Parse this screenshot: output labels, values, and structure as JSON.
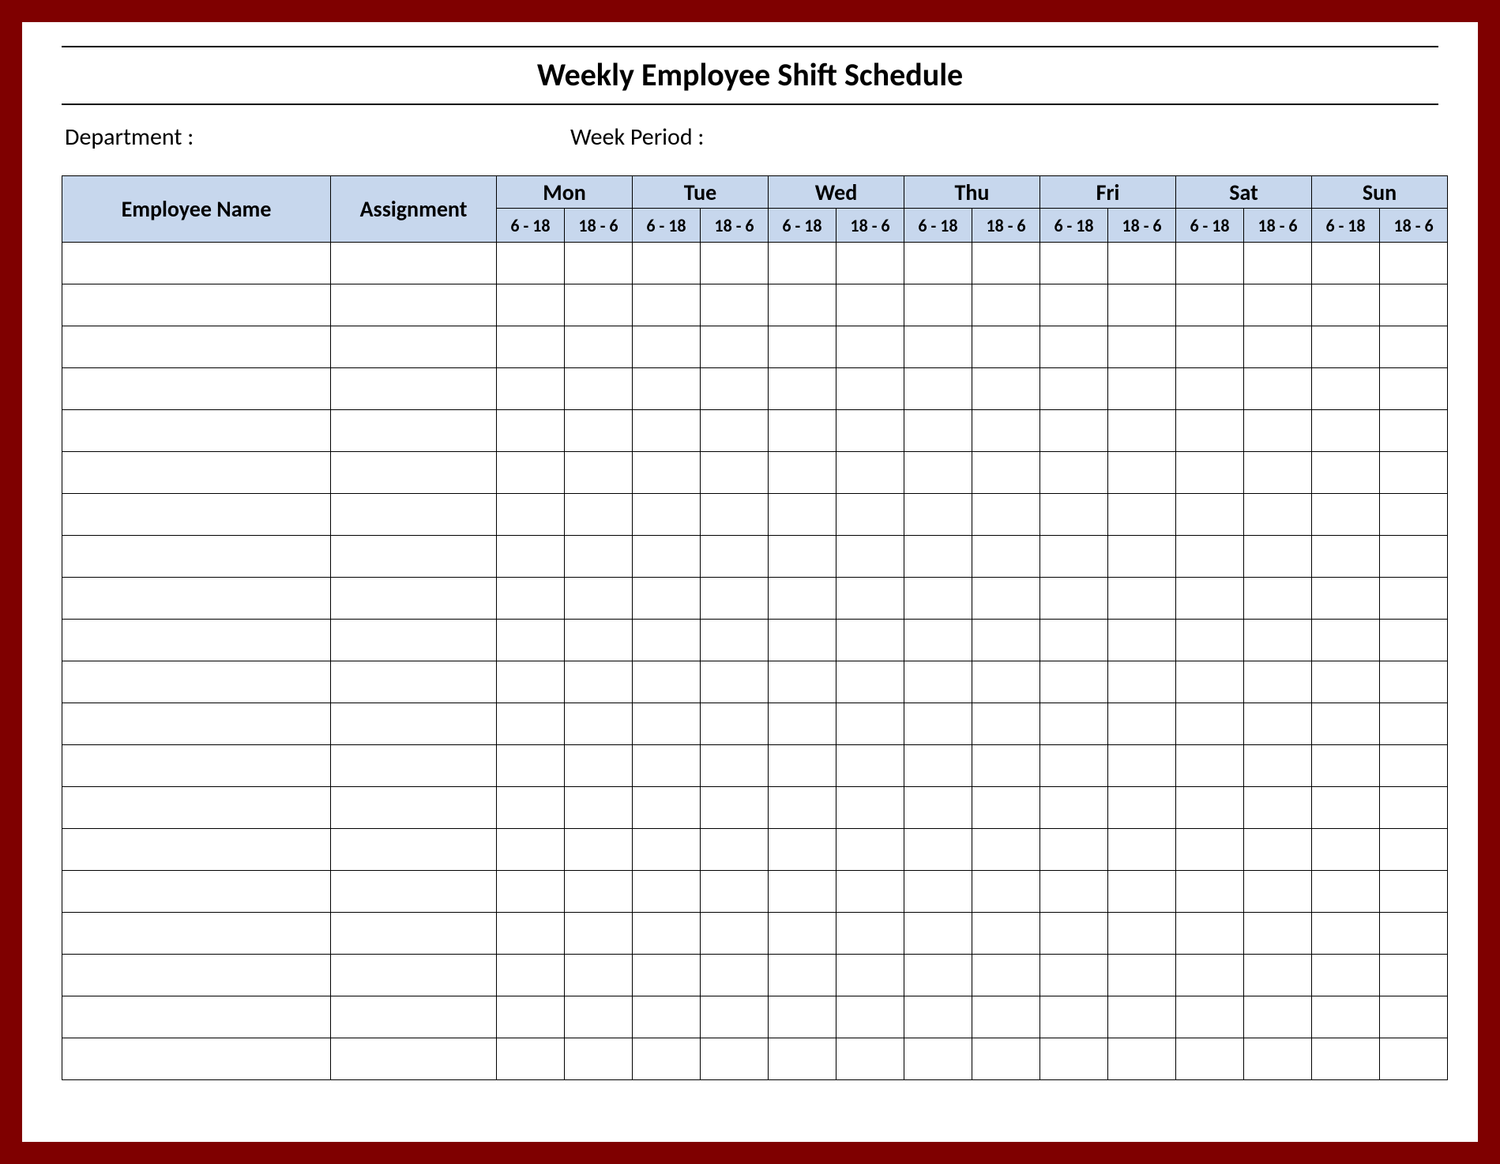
{
  "title": "Weekly Employee Shift Schedule",
  "labels": {
    "department": "Department :",
    "week_period": "Week  Period :",
    "employee_name": "Employee Name",
    "assignment": "Assignment"
  },
  "days": [
    "Mon",
    "Tue",
    "Wed",
    "Thu",
    "Fri",
    "Sat",
    "Sun"
  ],
  "shifts": [
    "6 - 18",
    "18 - 6"
  ],
  "row_count": 20,
  "colors": {
    "frame_border": "#7f0000",
    "header_fill": "#c7d7ed"
  }
}
